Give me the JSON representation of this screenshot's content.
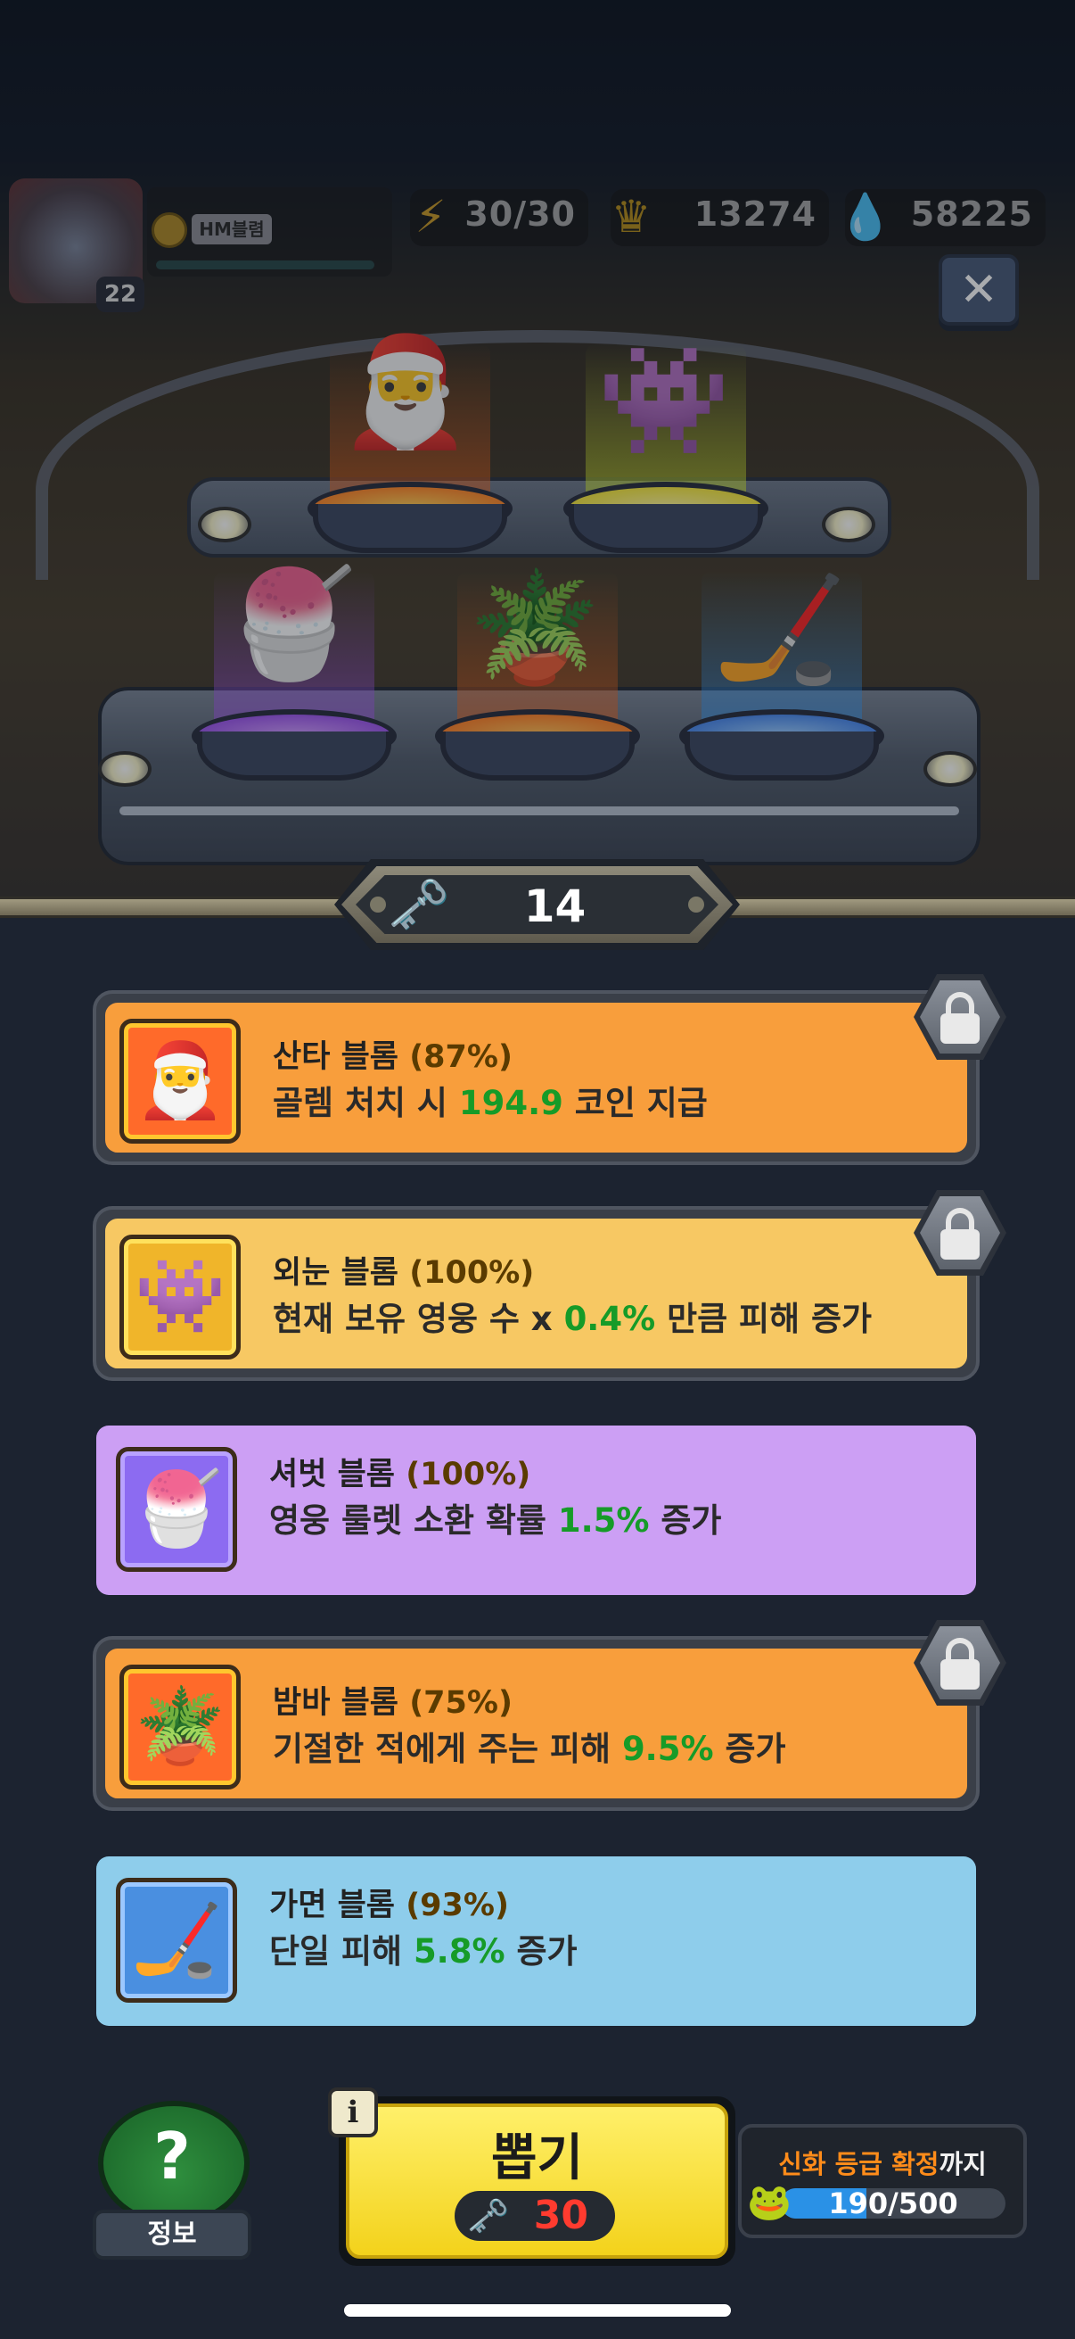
{
  "hud": {
    "level": "22",
    "name_tag": "HM블렴",
    "energy": "30/30",
    "crown": "13274",
    "gems": "58225",
    "close_icon": "close-icon"
  },
  "keys": {
    "count": "14"
  },
  "cards": [
    {
      "id": "santa",
      "locked": true,
      "color": "#f89e3c",
      "name": "산타 블롬",
      "percent": "(87%)",
      "desc_before": "골렘 처치 시 ",
      "desc_highlight": "194.9",
      "desc_after": " 코인 지급"
    },
    {
      "id": "cyclops",
      "locked": true,
      "color": "#f7c863",
      "name": "외눈 블롬",
      "percent": "(100%)",
      "desc_before": "현재 보유 영웅 수 x ",
      "desc_highlight": "0.4%",
      "desc_after": " 만큼 피해 증가"
    },
    {
      "id": "sherbet",
      "locked": false,
      "color": "#cc9ff4",
      "name": "셔벗 블롬",
      "percent": "(100%)",
      "desc_before": "영웅 룰렛 소환 확률 ",
      "desc_highlight": "1.5%",
      "desc_after": " 증가"
    },
    {
      "id": "bamba",
      "locked": true,
      "color": "#f89e3c",
      "name": "밤바 블롬",
      "percent": "(75%)",
      "desc_before": "기절한 적에게 주는 피해 ",
      "desc_highlight": "9.5%",
      "desc_after": " 증가"
    },
    {
      "id": "mask",
      "locked": false,
      "color": "#8ecdeb",
      "name": "가면 블롬",
      "percent": "(93%)",
      "desc_before": "단일 피해 ",
      "desc_highlight": "5.8%",
      "desc_after": " 증가"
    }
  ],
  "bottom": {
    "info_label": "정보",
    "draw_label": "뽑기",
    "draw_cost": "30",
    "mythic_prefix": "신화 등급 확정",
    "mythic_suffix": "까지",
    "mythic_progress": "190/500",
    "mythic_fraction": 0.38
  }
}
